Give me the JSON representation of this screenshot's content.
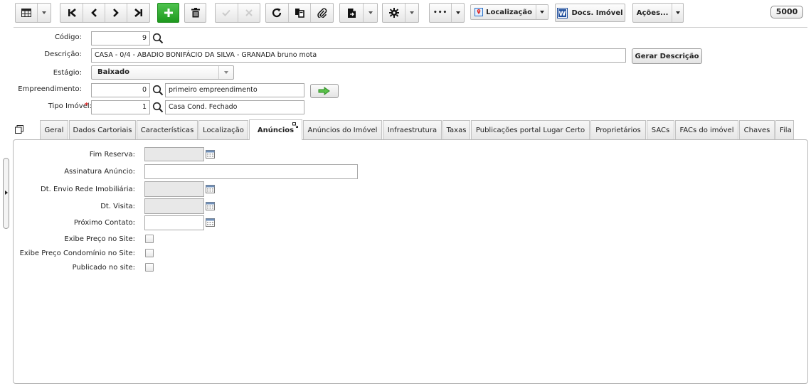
{
  "toolbar": {
    "localizacao_label": "Localização",
    "docs_imovel_label": "Docs. Imóvel",
    "acoes_label": "Ações...",
    "counter": "5000",
    "more_label": "•••"
  },
  "form": {
    "codigo": {
      "label": "Código:",
      "value": "9"
    },
    "descricao": {
      "label": "Descrição:",
      "value": "CASA - 0/4 - ABADIO BONIFÁCIO DA SILVA - GRANADA bruno mota"
    },
    "gerar_descricao": "Gerar Descrição",
    "estagio": {
      "label": "Estágio:",
      "value": "Baixado"
    },
    "empreendimento": {
      "label": "Empreendimento:",
      "code": "0",
      "name": "primeiro empreendimento"
    },
    "tipo_imovel": {
      "label": "Tipo Imóvel:",
      "required": "*",
      "code": "1",
      "name": "Casa Cond. Fechado"
    }
  },
  "tabs": [
    "Geral",
    "Dados Cartoriais",
    "Características",
    "Localização",
    "Anúncios",
    "Anúncios do Imóvel",
    "Infraestrutura",
    "Taxas",
    "Publicações portal Lugar Certo",
    "Proprietários",
    "SACs",
    "FACs do imóvel",
    "Chaves",
    "Fila"
  ],
  "active_tab": "Anúncios",
  "anuncios": {
    "fim_reserva": {
      "label": "Fim Reserva:",
      "value": ""
    },
    "assinatura_anuncio": {
      "label": "Assinatura Anúncio:",
      "value": ""
    },
    "dt_envio_rede": {
      "label": "Dt. Envio Rede Imobiliária:",
      "value": ""
    },
    "dt_visita": {
      "label": "Dt. Visita:",
      "value": ""
    },
    "proximo_contato": {
      "label": "Próximo Contato:",
      "value": ""
    },
    "exibe_preco_site": {
      "label": "Exibe Preço no Site:",
      "checked": false
    },
    "exibe_preco_condominio": {
      "label": "Exibe Preço Condomínio no Site:",
      "checked": false
    },
    "publicado_site": {
      "label": "Publicado no site:",
      "checked": false
    }
  }
}
